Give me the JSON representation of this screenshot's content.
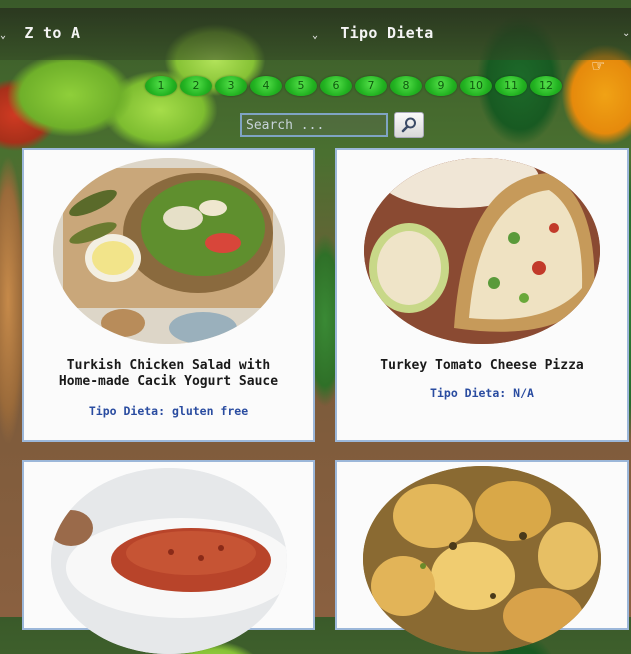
{
  "toolbar": {
    "sort_value": "Z to A",
    "diet_value": "Tipo Dieta"
  },
  "pagination": {
    "pages": [
      "1",
      "2",
      "3",
      "4",
      "5",
      "6",
      "7",
      "8",
      "9",
      "10",
      "11",
      "12"
    ]
  },
  "search": {
    "placeholder": "Search ..."
  },
  "recipes": [
    {
      "title": "Turkish Chicken Salad with Home-made Cacik Yogurt Sauce",
      "diet_label": "Tipo Dieta:",
      "diet_value": "gluten free"
    },
    {
      "title": "Turkey Tomato Cheese Pizza",
      "diet_label": "Tipo Dieta:",
      "diet_value": "N/A"
    },
    {
      "title": "",
      "diet_label": "",
      "diet_value": ""
    },
    {
      "title": "",
      "diet_label": "",
      "diet_value": ""
    }
  ],
  "colors": {
    "page_green": "#22b321",
    "card_border": "#9cb7d9",
    "diet_text": "#2a4ca0"
  }
}
